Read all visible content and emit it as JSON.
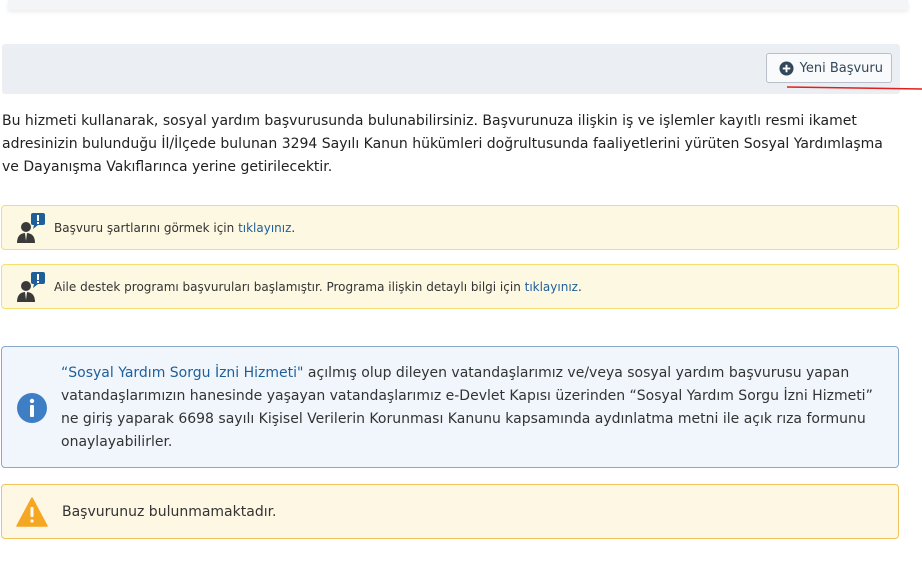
{
  "toolbar": {
    "new_application_label": "Yeni Başvuru",
    "plus_icon": "plus-circle-icon"
  },
  "intro": {
    "text": "Bu hizmeti kullanarak, sosyal yardım başvurusunda bulunabilirsiniz. Başvurunuza ilişkin iş ve işlemler kayıtlı resmi ikamet adresinizin bulunduğu İl/İlçede bulunan 3294 Sayılı Kanun hükümleri doğrultusunda faaliyetlerini yürüten Sosyal Yardımlaşma ve Dayanışma Vakıflarınca yerine getirilecektir."
  },
  "alerts": [
    {
      "icon": "person-alert-icon",
      "text": "Başvuru şartlarını görmek için ",
      "link": "tıklayınız",
      "suffix": "."
    },
    {
      "icon": "person-alert-icon",
      "text": "Aile destek programı başvuruları başlamıştır. Programa ilişkin detaylı bilgi için ",
      "link": "tıklayınız",
      "suffix": "."
    }
  ],
  "info": {
    "icon": "info-icon",
    "link": "“Sosyal Yardım Sorgu İzni Hizmeti\"",
    "text": " açılmış olup dileyen vatandaşlarımız ve/veya sosyal yardım başvurusu yapan vatandaşlarımızın hanesinde yaşayan vatandaşlarımız e-Devlet Kapısı üzerinden “Sosyal Yardım Sorgu İzni Hizmeti” ne giriş yaparak 6698 sayılı Kişisel Verilerin Korunması Kanunu kapsamında aydınlatma metni ile açık rıza formunu onaylayabilirler."
  },
  "warning": {
    "icon": "warning-icon",
    "text": "Başvurunuz bulunmamaktadır."
  },
  "colors": {
    "link": "#1f5f99",
    "info_border": "#8aa9c7",
    "warning_border": "#f0c45a",
    "alert_border": "#f3de72",
    "annotation_red": "#e0201b"
  }
}
